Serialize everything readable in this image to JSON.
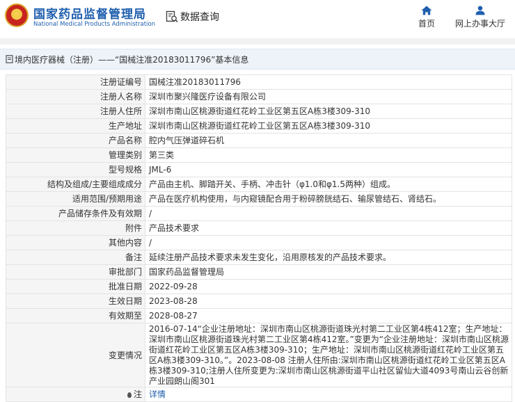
{
  "header": {
    "site_name_cn": "国家药品监督管理局",
    "site_name_en": "National Medical Products Administration",
    "section_title": "数据查询",
    "nav": {
      "home_label": "首页",
      "online_label": "网上办事大厅"
    }
  },
  "breadcrumb": {
    "text": "境内医疗器械（注册）——“国械注准20183011796”基本信息"
  },
  "record": {
    "rows": [
      {
        "key": "注册证编号",
        "value": "国械注准20183011796"
      },
      {
        "key": "注册人名称",
        "value": "深圳市聚兴隆医疗设备有限公司"
      },
      {
        "key": "注册人住所",
        "value": "深圳市南山区桃源街道红花岭工业区第五区A栋3楼309-310"
      },
      {
        "key": "生产地址",
        "value": "深圳市南山区桃源街道红花岭工业区第五区A栋3楼309-310"
      },
      {
        "key": "产品名称",
        "value": "腔内气压弹道碎石机"
      },
      {
        "key": "管理类别",
        "value": "第三类"
      },
      {
        "key": "型号规格",
        "value": "JML-6"
      },
      {
        "key": "结构及组成/主要组成成分",
        "value": "产品由主机、脚踏开关、手柄、冲击针（φ1.0和φ1.5两种）组成。"
      },
      {
        "key": "适用范围/预期用途",
        "value": "产品在医疗机构使用，与内窥镜配合用于粉碎膀胱结石、输尿管结石、肾结石。"
      },
      {
        "key": "产品储存条件及有效期",
        "value": "/"
      },
      {
        "key": "附件",
        "value": "产品技术要求"
      },
      {
        "key": "其他内容",
        "value": "/"
      },
      {
        "key": "备注",
        "value": "延续注册产品技术要求未发生变化，沿用原核发的产品技术要求。"
      },
      {
        "key": "审批部门",
        "value": "国家药品监督管理局"
      },
      {
        "key": "批准日期",
        "value": "2022-09-28"
      },
      {
        "key": "生效日期",
        "value": "2023-08-28"
      },
      {
        "key": "有效期至",
        "value": "2028-08-27"
      }
    ],
    "change_key": "变更情况",
    "change_text": "2016-07-14“企业注册地址：深圳市南山区桃源街道珠光村第二工业区第4栋412室；生产地址：深圳市南山区桃源街道珠光村第二工业区第4栋412室。”变更为“企业注册地址：深圳市南山区桃源街道红花岭工业区第五区A栋3楼309-310；生产地址：深圳市南山区桃源街道红花岭工业区第五区A栋3楼309-310。”。2023-08-08 注册人住所由:深圳市南山区桃源街道红花岭工业区第五区A栋3楼309-310;注册人住所变更为:深圳市南山区桃源街道平山社区留仙大道4093号南山云谷创新产业园朗山阁301",
    "note_key": "注",
    "note_link": "详情"
  }
}
